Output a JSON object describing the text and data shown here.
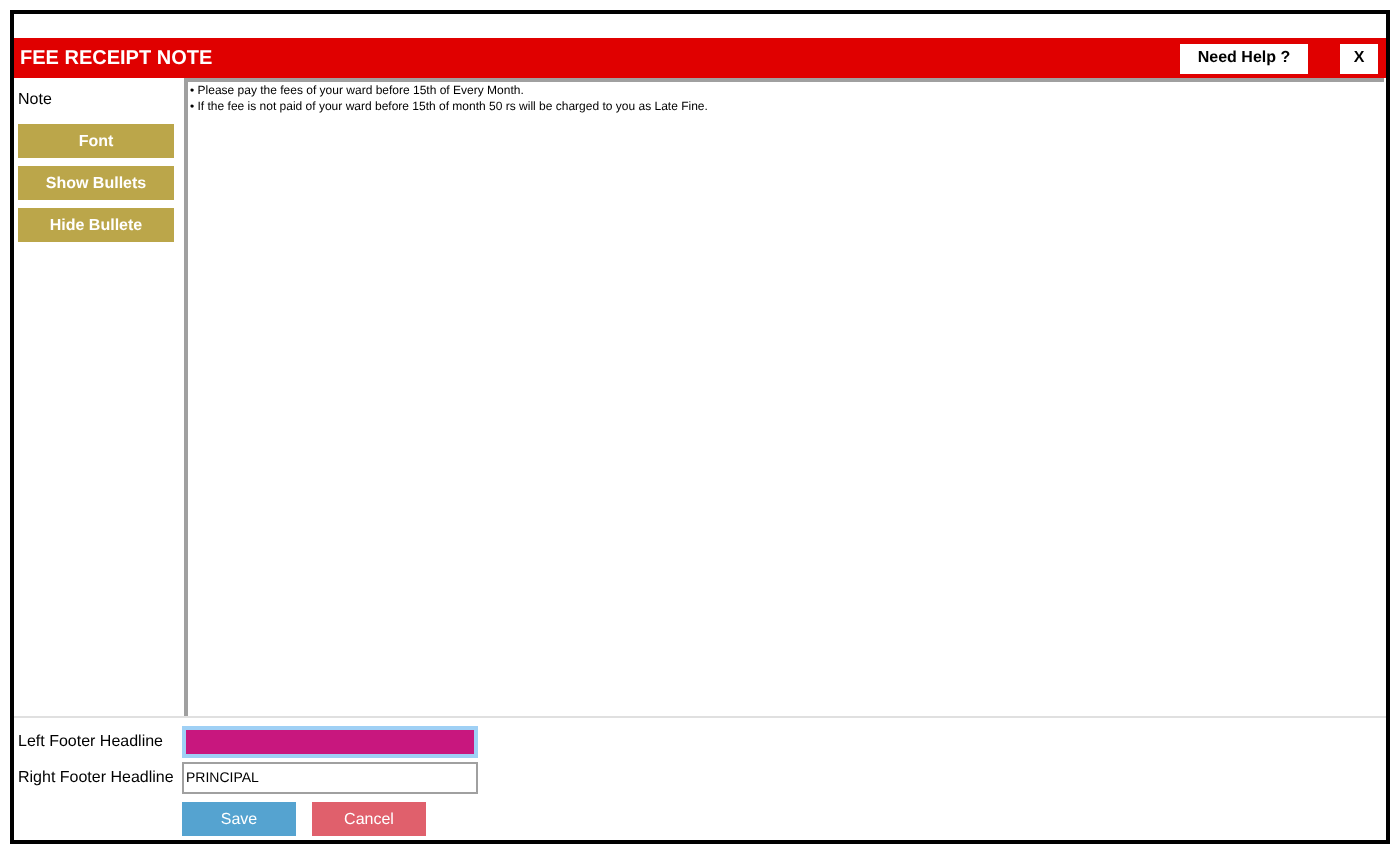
{
  "window": {
    "title": "FEE RECEIPT NOTE",
    "help_button": "Need Help ?",
    "close_button": "X"
  },
  "sidebar": {
    "label": "Note",
    "buttons": [
      "Font",
      "Show Bullets",
      "Hide Bullete"
    ]
  },
  "note_lines": [
    "• Please pay the fees of your ward before 15th of Every Month.",
    "• If the fee is not paid of your ward before 15th of month 50 rs will be charged to you as Late Fine."
  ],
  "footer_fields": [
    {
      "label": "Left Footer Headline",
      "focused": true
    },
    {
      "label": "Right Footer Headline",
      "value": "PRINCIPAL",
      "focused": false
    }
  ],
  "buttons": [
    {
      "label": "Save",
      "kind": "primary"
    },
    {
      "label": "Cancel",
      "kind": "danger"
    }
  ]
}
